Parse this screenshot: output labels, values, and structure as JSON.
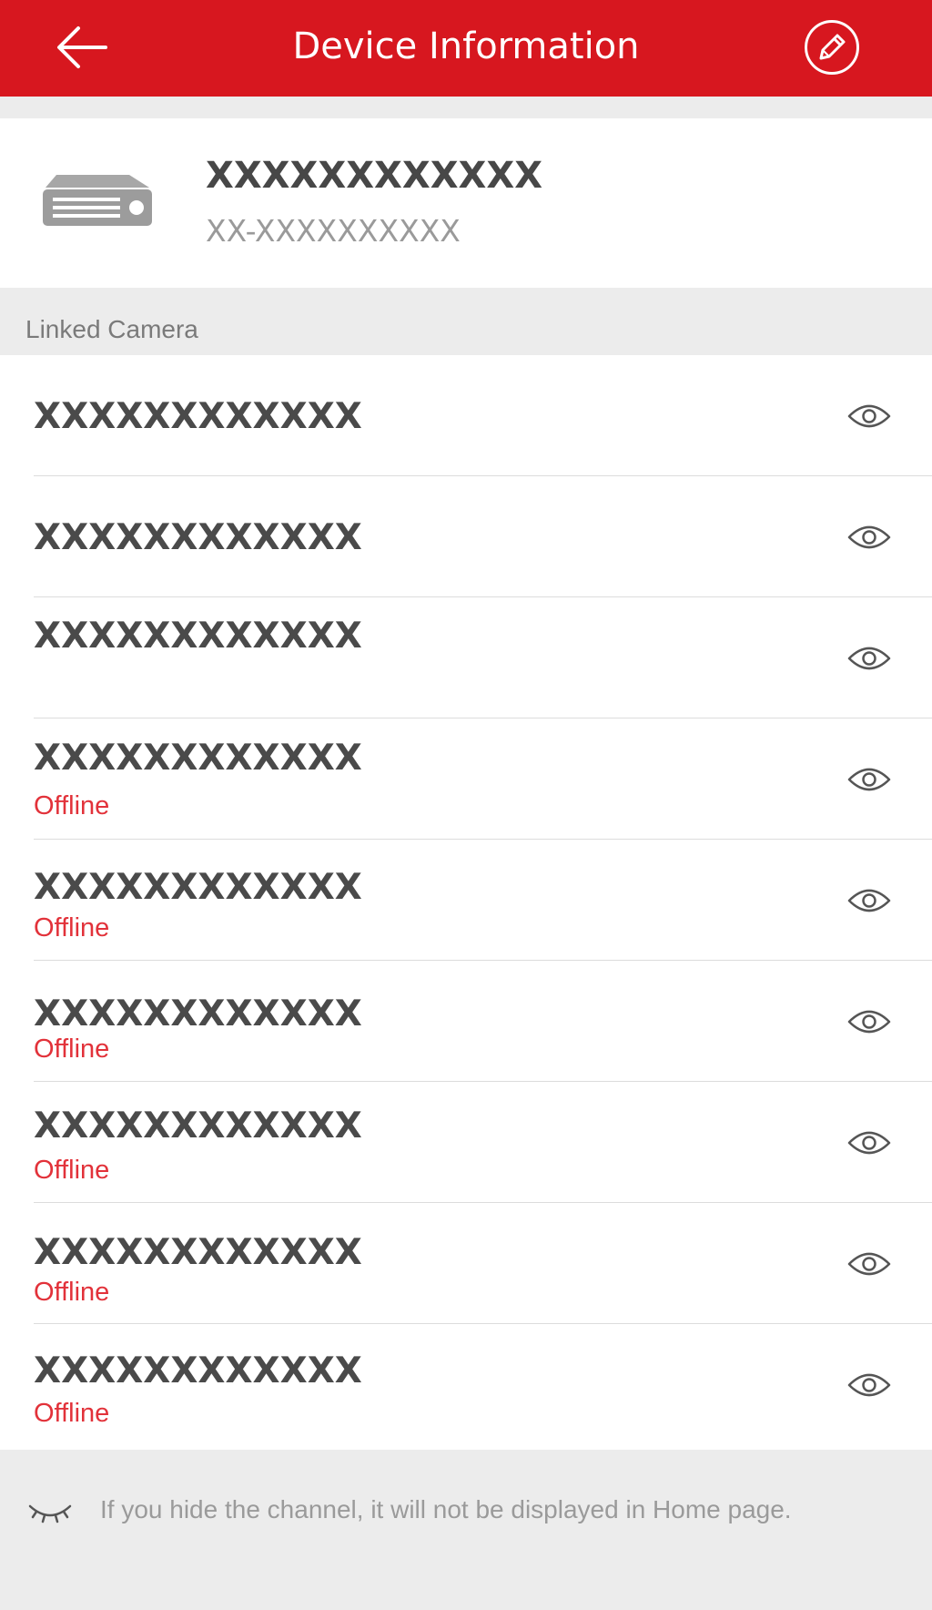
{
  "header": {
    "title": "Device Information",
    "back_icon": "arrow-left-icon",
    "edit_icon": "pencil-icon"
  },
  "colors": {
    "header_red": "#d7171f",
    "offline_red": "#e2323a",
    "background_gray": "#ececec"
  },
  "device": {
    "icon": "dvr-recorder-icon",
    "name": "XXXXXXXXXXXX",
    "serial": "XX-XXXXXXXXXX"
  },
  "linked_camera": {
    "label": "Linked Camera",
    "cameras": [
      {
        "name": "XXXXXXXXXXXX",
        "status": ""
      },
      {
        "name": "XXXXXXXXXXXX",
        "status": ""
      },
      {
        "name": "XXXXXXXXXXXX",
        "status": ""
      },
      {
        "name": "XXXXXXXXXXXX",
        "status": "Offline"
      },
      {
        "name": "XXXXXXXXXXXX",
        "status": "Offline"
      },
      {
        "name": "XXXXXXXXXXXX",
        "status": "Offline"
      },
      {
        "name": "XXXXXXXXXXXX",
        "status": "Offline"
      },
      {
        "name": "XXXXXXXXXXXX",
        "status": "Offline"
      },
      {
        "name": "XXXXXXXXXXXX",
        "status": "Offline"
      }
    ]
  },
  "footer": {
    "icon": "eye-closed-icon",
    "note": "If you hide the channel, it will not be displayed in Home page."
  }
}
